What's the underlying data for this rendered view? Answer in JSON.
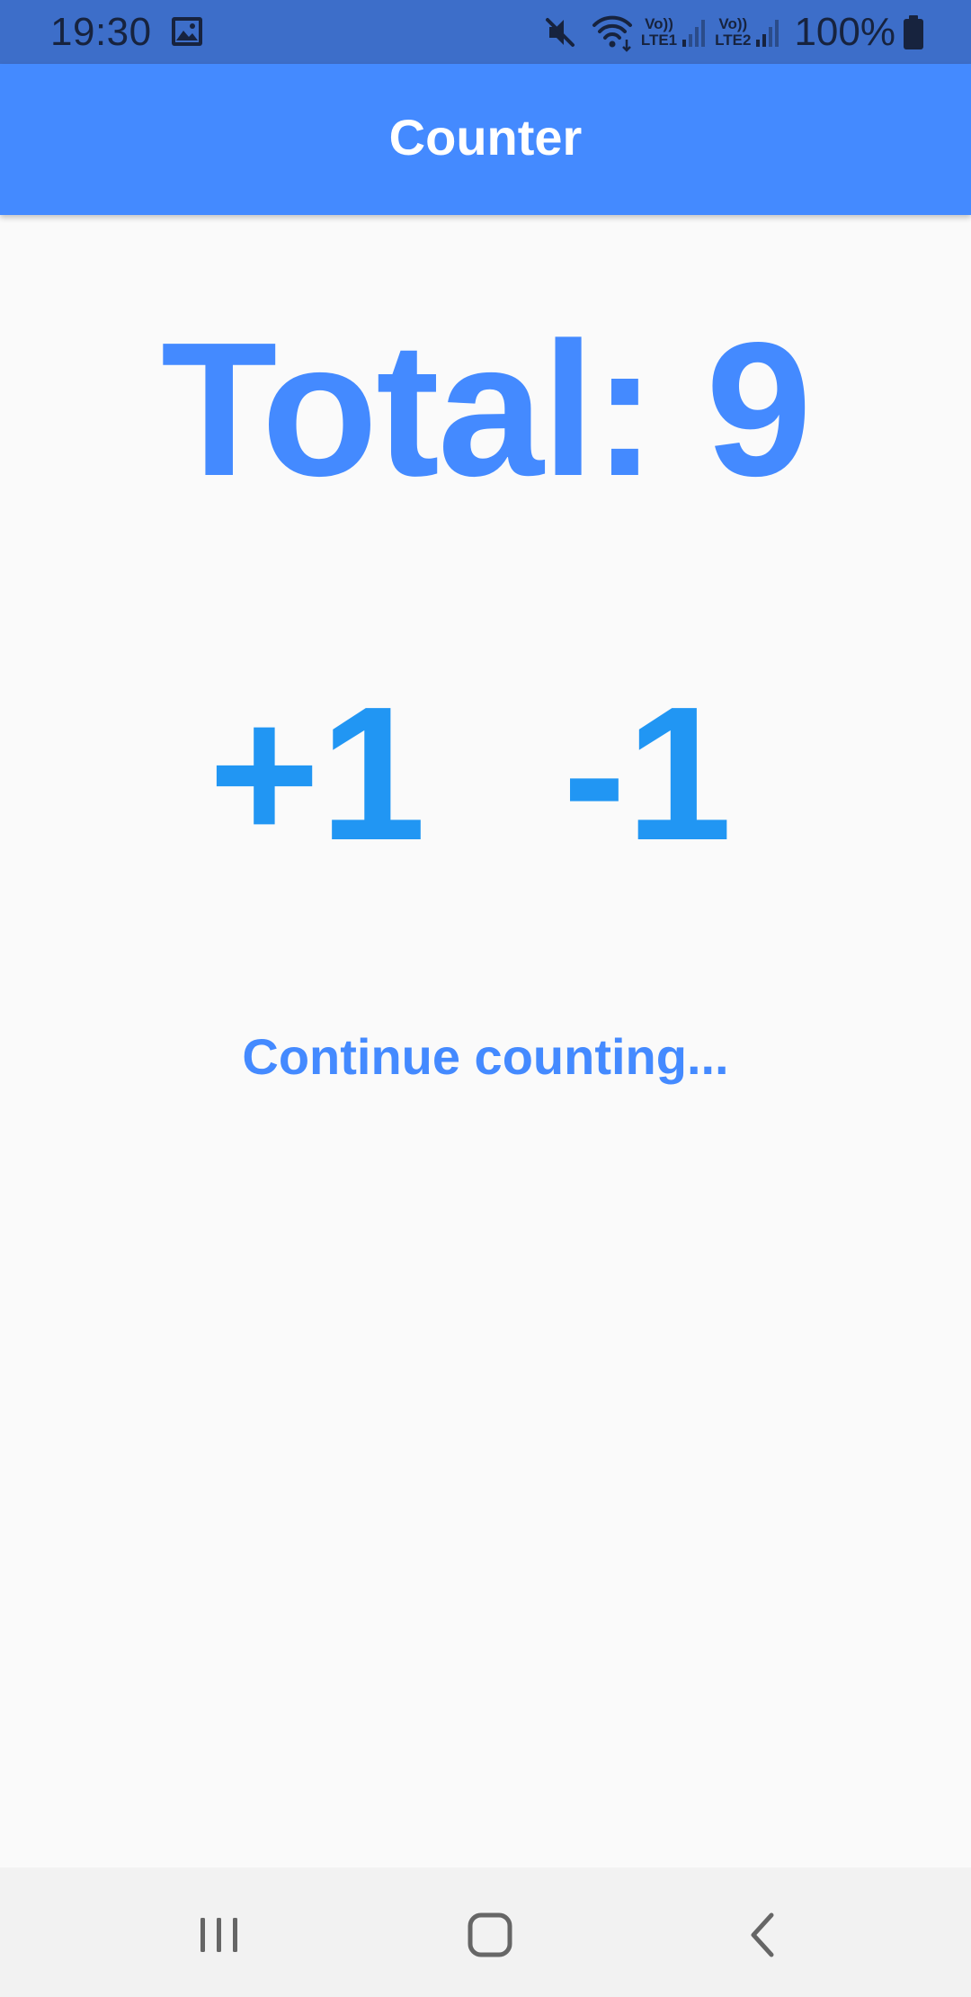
{
  "status_bar": {
    "time": "19:30",
    "battery": "100%",
    "icons": [
      "image-icon",
      "mute-icon",
      "wifi-icon",
      "lte1-signal-icon",
      "lte2-signal-icon",
      "battery-icon"
    ],
    "lte1_label": "LTE1",
    "lte2_label": "LTE2",
    "volte_label": "Vo))"
  },
  "app_bar": {
    "title": "Counter"
  },
  "main": {
    "total_label": "Total: 9",
    "increment_label": "+1",
    "decrement_label": "-1",
    "continue_text": "Continue counting..."
  },
  "nav_bar": {
    "icons": [
      "recents-icon",
      "home-icon",
      "back-icon"
    ]
  },
  "colors": {
    "status_bar": "#3d6ec9",
    "app_bar": "#448aff",
    "accent_text": "#448aff",
    "button_text": "#2196f3",
    "background": "#fafafa",
    "nav_bar": "#f2f2f2"
  }
}
